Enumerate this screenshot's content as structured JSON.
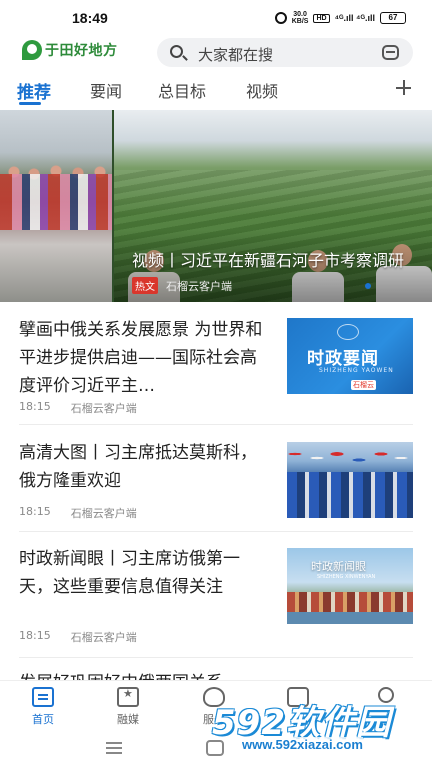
{
  "status_bar": {
    "time": "18:49",
    "speed": "30.0\nKB/S",
    "hd": "HD",
    "signal": "⁴ᴳ.ıll ⁴ᴳ.ıll",
    "battery": "67"
  },
  "header": {
    "logo_text": "于田好地方",
    "search_placeholder": "大家都在搜"
  },
  "tabs": [
    {
      "label": "推荐",
      "active": true
    },
    {
      "label": "要闻",
      "active": false
    },
    {
      "label": "总目标",
      "active": false
    },
    {
      "label": "视频",
      "active": false
    }
  ],
  "banner": {
    "title": "视频丨习近平在新疆石河子市考察调研",
    "badge": "热文",
    "source": "石榴云客户端"
  },
  "news": [
    {
      "title": "擘画中俄关系发展愿景 为世界和平进步提供启迪——国际社会高度评价习近平主…",
      "time": "18:15",
      "source": "石榴云客户端",
      "thumb_title": "时政要闻",
      "thumb_sub": "SHIZHENG YAOWEN",
      "thumb_logo": "石榴云"
    },
    {
      "title": "高清大图丨习主席抵达莫斯科，俄方隆重欢迎",
      "time": "18:15",
      "source": "石榴云客户端"
    },
    {
      "title": "时政新闻眼丨习主席访俄第一天，这些重要信息值得关注",
      "time": "18:15",
      "source": "石榴云客户端",
      "thumb_title": "时政新闻眼",
      "thumb_sub": "SHIZHENG XINWENYAN"
    },
    {
      "title": "发展好巩固好中俄两国关系…"
    }
  ],
  "bottom_nav": [
    {
      "label": "首页",
      "icon": "home-icon",
      "active": true
    },
    {
      "label": "融媒",
      "icon": "media-icon",
      "active": false
    },
    {
      "label": "服务",
      "icon": "service-icon",
      "active": false
    },
    {
      "label": "",
      "icon": "chat-icon",
      "active": false
    },
    {
      "label": "",
      "icon": "user-icon",
      "active": false
    }
  ],
  "watermark": {
    "main": "592软件园",
    "url": "www.592xiazai.com"
  },
  "colors": {
    "accent": "#1a72d1",
    "brand_green": "#2e8b3a",
    "hot_red": "#d9362c"
  }
}
